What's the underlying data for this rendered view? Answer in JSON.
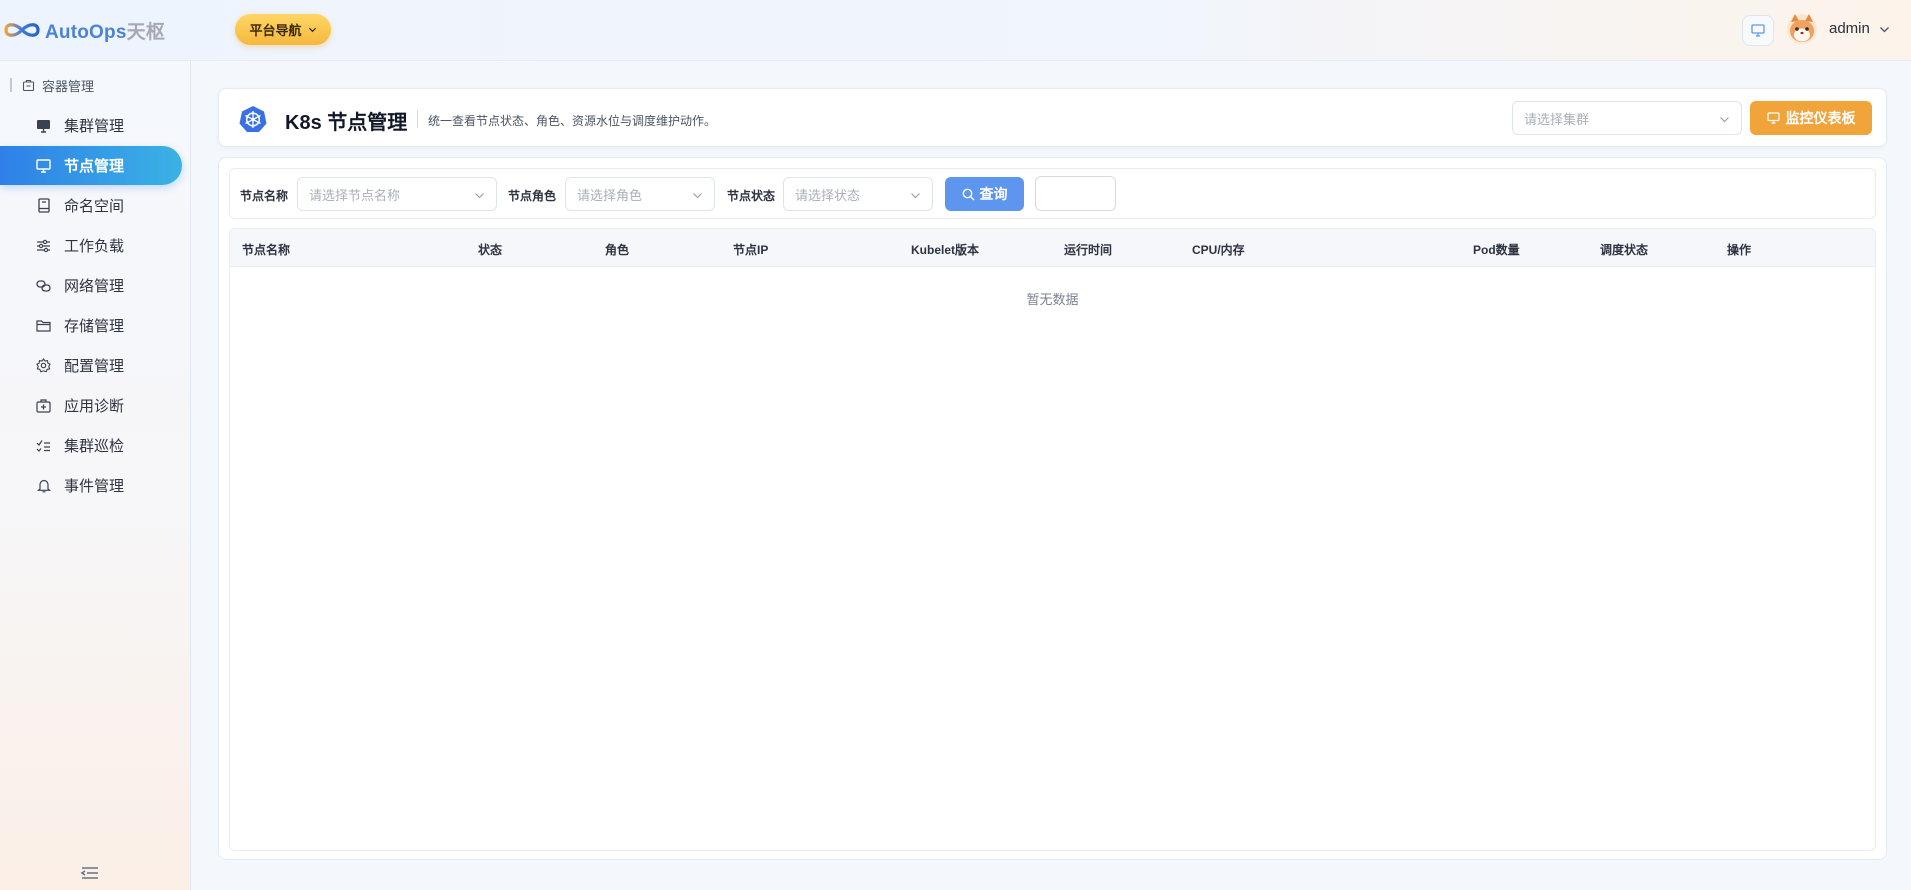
{
  "header": {
    "logo_text_a": "AutoOps",
    "logo_text_b": "天枢",
    "platform_nav_label": "平台导航",
    "user_name": "admin"
  },
  "sidebar": {
    "group_title": "容器管理",
    "items": [
      {
        "label": "集群管理",
        "icon": "monitor-solid-icon"
      },
      {
        "label": "节点管理",
        "icon": "monitor-icon",
        "active": true
      },
      {
        "label": "命名空间",
        "icon": "book-icon"
      },
      {
        "label": "工作负载",
        "icon": "sliders-icon"
      },
      {
        "label": "网络管理",
        "icon": "link-icon"
      },
      {
        "label": "存储管理",
        "icon": "folder-icon"
      },
      {
        "label": "配置管理",
        "icon": "gear-icon"
      },
      {
        "label": "应用诊断",
        "icon": "medical-kit-icon"
      },
      {
        "label": "集群巡检",
        "icon": "checklist-icon"
      },
      {
        "label": "事件管理",
        "icon": "bell-icon"
      }
    ]
  },
  "page": {
    "title": "K8s 节点管理",
    "description": "统一查看节点状态、角色、资源水位与调度维护动作。",
    "cluster_placeholder": "请选择集群",
    "dashboard_label": "监控仪表板"
  },
  "filters": {
    "node_name_label": "节点名称",
    "node_name_placeholder": "请选择节点名称",
    "node_role_label": "节点角色",
    "node_role_placeholder": "请选择角色",
    "node_status_label": "节点状态",
    "node_status_placeholder": "请选择状态",
    "query_label": "查询"
  },
  "table": {
    "columns": [
      "节点名称",
      "状态",
      "角色",
      "节点IP",
      "Kubelet版本",
      "运行时间",
      "CPU/内存",
      "Pod数量",
      "调度状态",
      "操作"
    ],
    "rows": [],
    "empty_text": "暂无数据"
  },
  "colors": {
    "accent": "#2f80e8",
    "primary_button": "#5e95ee",
    "warning_button": "#f0a43a"
  }
}
